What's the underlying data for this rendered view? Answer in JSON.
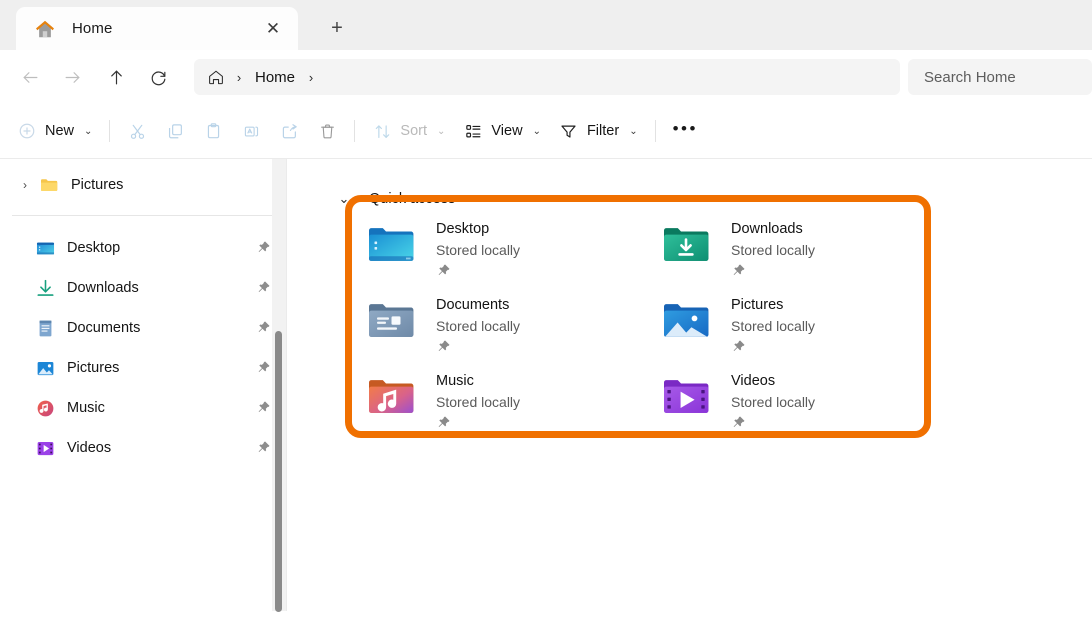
{
  "window": {
    "app": "File Explorer"
  },
  "titlebar": {
    "tab": {
      "label": "Home",
      "icon": "home-icon",
      "close_label": "✕"
    },
    "new_tab_label": "+"
  },
  "navbar": {
    "back": {
      "name": "back-button",
      "enabled": false
    },
    "forward": {
      "name": "forward-button",
      "enabled": false
    },
    "up": {
      "name": "up-button",
      "enabled": true
    },
    "refresh": {
      "name": "refresh-button",
      "enabled": true
    },
    "breadcrumb": {
      "home_icon": "home-icon",
      "sep1": "›",
      "crumb": "Home",
      "sep2": "›"
    },
    "search": {
      "placeholder": "Search Home",
      "label": "Search Home"
    }
  },
  "toolbar": {
    "new_label": "New",
    "new_caret": "⌄",
    "cut_label": "Cut",
    "copy_label": "Copy",
    "paste_label": "Paste",
    "rename_label": "Rename",
    "share_label": "Share",
    "delete_label": "Delete",
    "sort_label": "Sort",
    "sort_caret": "⌄",
    "view_label": "View",
    "view_caret": "⌄",
    "filter_label": "Filter",
    "filter_caret": "⌄",
    "more_label": "•••"
  },
  "nav_pane": {
    "tree": [
      {
        "label": "Pictures",
        "icon": "folder-icon",
        "chevron": "›",
        "expandable": true
      }
    ],
    "quick_items": [
      {
        "label": "Desktop",
        "icon": "desktop-folder-icon",
        "pinned": true
      },
      {
        "label": "Downloads",
        "icon": "downloads-folder-icon",
        "pinned": true
      },
      {
        "label": "Documents",
        "icon": "documents-folder-icon",
        "pinned": true
      },
      {
        "label": "Pictures",
        "icon": "pictures-folder-icon",
        "pinned": true
      },
      {
        "label": "Music",
        "icon": "music-folder-icon",
        "pinned": true
      },
      {
        "label": "Videos",
        "icon": "videos-folder-icon",
        "pinned": true
      }
    ]
  },
  "content": {
    "section": {
      "title": "Quick access",
      "chevron": "⌄",
      "expanded": true
    },
    "highlight_color": "#f07000",
    "items": [
      {
        "name": "Desktop",
        "status": "Stored locally",
        "icon": "desktop-folder-icon",
        "pinned": true
      },
      {
        "name": "Downloads",
        "status": "Stored locally",
        "icon": "downloads-folder-icon",
        "pinned": true
      },
      {
        "name": "Documents",
        "status": "Stored locally",
        "icon": "documents-folder-icon",
        "pinned": true
      },
      {
        "name": "Pictures",
        "status": "Stored locally",
        "icon": "pictures-folder-icon",
        "pinned": true
      },
      {
        "name": "Music",
        "status": "Stored locally",
        "icon": "music-folder-icon",
        "pinned": true
      },
      {
        "name": "Videos",
        "status": "Stored locally",
        "icon": "videos-folder-icon",
        "pinned": true
      }
    ]
  },
  "colors": {
    "accent_orange": "#f07000",
    "titlebar_bg": "#efefef",
    "field_bg": "#f4f4f4"
  }
}
